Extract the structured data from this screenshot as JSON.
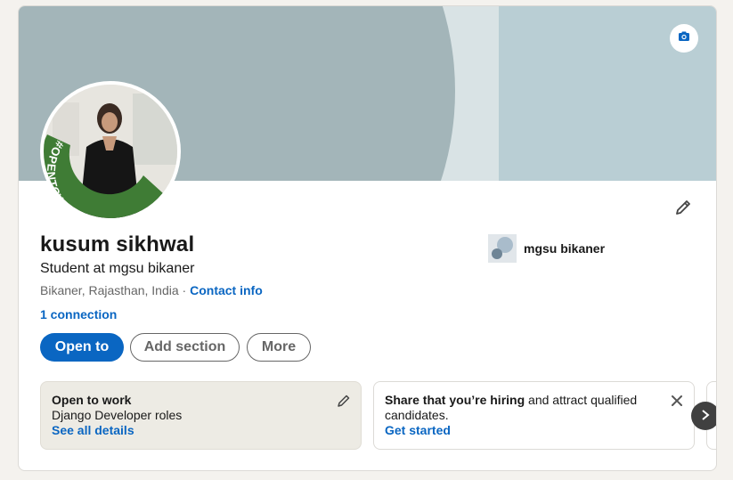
{
  "profile": {
    "name": "kusum sikhwal",
    "headline": "Student at mgsu bikaner",
    "location": "Bikaner, Rajasthan, India",
    "separator": " · ",
    "contact_info": "Contact info",
    "connections": "1 connection",
    "open_to_work_badge": "#OPENTOWORK"
  },
  "education": {
    "name": "mgsu bikaner"
  },
  "actions": {
    "open_to": "Open to",
    "add_section": "Add section",
    "more": "More"
  },
  "panels": {
    "open_to_work": {
      "title": "Open to work",
      "roles": "Django Developer roles",
      "link": "See all details"
    },
    "hiring": {
      "title": "Share that you’re hiring",
      "rest": " and attract qualified candidates.",
      "link": "Get started"
    }
  },
  "colors": {
    "accent": "#0a66c2",
    "open_to_work_green": "#3f7c35",
    "banner": "#a3b5b9"
  },
  "icons": [
    "camera-icon",
    "pencil-icon",
    "close-icon",
    "chevron-right-icon"
  ]
}
